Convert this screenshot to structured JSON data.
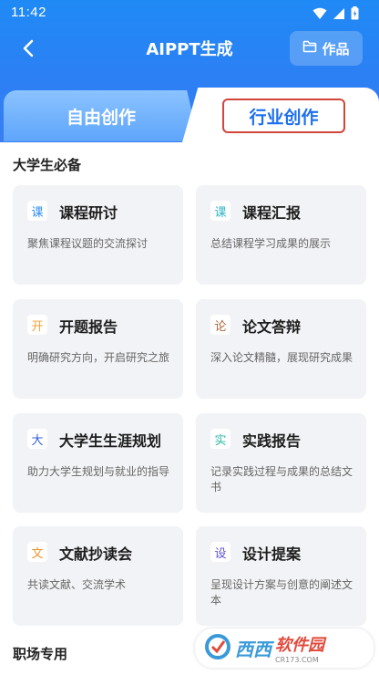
{
  "status": {
    "time": "11:42"
  },
  "header": {
    "title": "AIPPT生成",
    "works_label": "作品"
  },
  "tabs": [
    {
      "label": "自由创作",
      "selected": false
    },
    {
      "label": "行业创作",
      "selected": true
    }
  ],
  "sections": [
    {
      "title": "大学生必备"
    },
    {
      "title": "职场专用"
    }
  ],
  "cards": [
    {
      "badge": "课",
      "badge_color": "#2f8cf5",
      "title": "课程研讨",
      "desc": "聚焦课程议题的交流探讨"
    },
    {
      "badge": "课",
      "badge_color": "#2fb6c8",
      "title": "课程汇报",
      "desc": "总结课程学习成果的展示"
    },
    {
      "badge": "开",
      "badge_color": "#f2a23a",
      "title": "开题报告",
      "desc": "明确研究方向，开启研究之旅"
    },
    {
      "badge": "论",
      "badge_color": "#a9663a",
      "title": "论文答辩",
      "desc": "深入论文精髓，展现研究成果"
    },
    {
      "badge": "大",
      "badge_color": "#2f5fe0",
      "title": "大学生生涯规划",
      "desc": "助力大学生规划与就业的指导"
    },
    {
      "badge": "实",
      "badge_color": "#2fb8a8",
      "title": "实践报告",
      "desc": "记录实践过程与成果的总结文书"
    },
    {
      "badge": "文",
      "badge_color": "#e8962c",
      "title": "文献抄读会",
      "desc": "共读文献、交流学术"
    },
    {
      "badge": "设",
      "badge_color": "#5b4fd8",
      "title": "设计提案",
      "desc": "呈现设计方案与创意的阐述文本"
    }
  ],
  "watermark": {
    "main": "西西",
    "name": "软件园",
    "url": "CR173.COM"
  },
  "icons": {
    "back": "chevron-left-icon",
    "works": "folder-icon",
    "wifi": "wifi-icon",
    "signal": "signal-icon",
    "battery": "battery-icon"
  },
  "colors": {
    "brand": "#2d7ff4",
    "tab_selected_text": "#1d6ff0",
    "highlight_border": "#d2453b",
    "card_bg": "#f2f3f6"
  }
}
